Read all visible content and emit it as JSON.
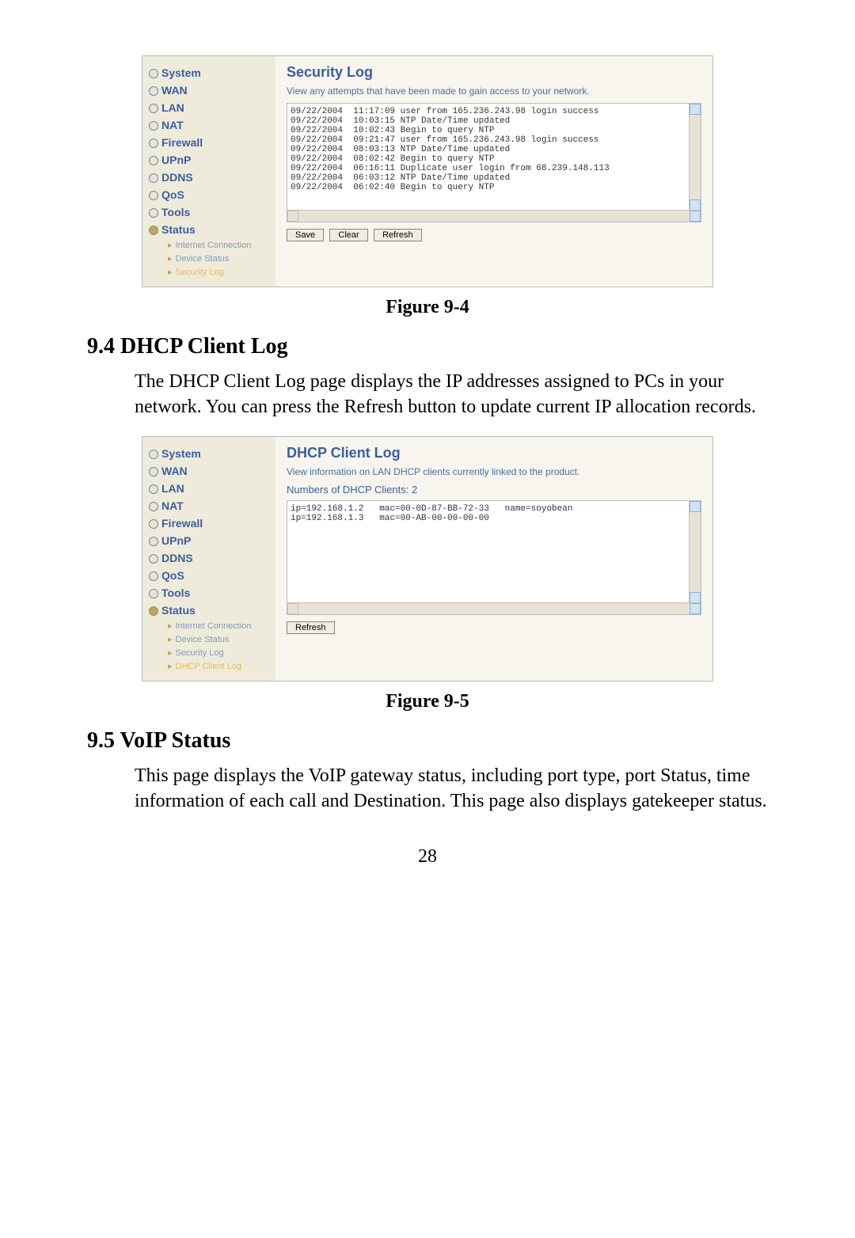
{
  "nav": {
    "items": [
      "System",
      "WAN",
      "LAN",
      "NAT",
      "Firewall",
      "UPnP",
      "DDNS",
      "QoS",
      "Tools",
      "Status"
    ],
    "sub_shot1": [
      "Internet Connection",
      "Device Status",
      "Security Log"
    ],
    "sub_shot2": [
      "Internet Connection",
      "Device Status",
      "Security Log",
      "DHCP Client Log"
    ]
  },
  "shot1": {
    "title": "Security Log",
    "subtitle": "View any attempts that have been made to gain access to your network.",
    "log": "09/22/2004  11:17:09 user from 165.236.243.98 login success\n09/22/2004  10:03:15 NTP Date/Time updated\n09/22/2004  10:02:43 Begin to query NTP\n09/22/2004  09:21:47 user from 165.236.243.98 login success\n09/22/2004  08:03:13 NTP Date/Time updated\n09/22/2004  08:02:42 Begin to query NTP\n09/22/2004  06:16:11 Duplicate user login from 68.239.148.113\n09/22/2004  06:03:12 NTP Date/Time updated\n09/22/2004  06:02:40 Begin to query NTP",
    "buttons": {
      "save": "Save",
      "clear": "Clear",
      "refresh": "Refresh"
    }
  },
  "caption1": "Figure 9-4",
  "heading94": "9.4 DHCP Client Log",
  "para94": "The DHCP Client Log page displays the IP addresses assigned to PCs in your network. You can press the Refresh button to update current IP allocation records.",
  "shot2": {
    "title": "DHCP Client Log",
    "subtitle": "View information on LAN DHCP clients currently linked to the product.",
    "numbers": "Numbers of DHCP Clients:  2",
    "log": "ip=192.168.1.2   mac=00-0D-87-BB-72-33   name=soyobean\nip=192.168.1.3   mac=00-AB-00-00-00-00",
    "buttons": {
      "refresh": "Refresh"
    }
  },
  "caption2": "Figure 9-5",
  "heading95": "9.5 VoIP Status",
  "para95": "This page displays the VoIP gateway status, including port type, port Status, time information of each call and Destination. This page also displays gatekeeper status.",
  "page_number": "28"
}
